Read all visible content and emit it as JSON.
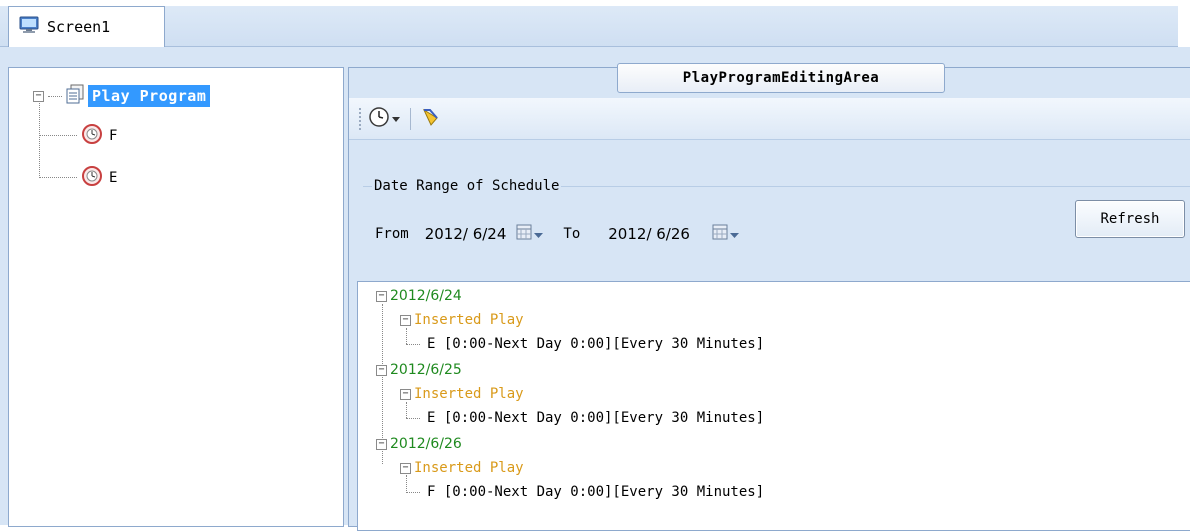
{
  "tabs": [
    {
      "label": "Screen1",
      "icon": "monitor-icon"
    }
  ],
  "program_tree": {
    "root": {
      "label": "Play Program",
      "icon": "pages-icon"
    },
    "children": [
      {
        "label": "F",
        "icon": "clock-icon"
      },
      {
        "label": "E",
        "icon": "clock-icon"
      }
    ]
  },
  "editing_area": {
    "title": "PlayProgramEditingArea",
    "toolbar": [
      {
        "name": "clock-dropdown",
        "icon": "clock-icon"
      },
      {
        "name": "clear-tool",
        "icon": "eraser-icon"
      }
    ],
    "schedule": {
      "caption": "Date Range of Schedule",
      "from_label": "From",
      "from_value": "2012/ 6/24",
      "to_label": "To",
      "to_value": "2012/ 6/26",
      "refresh_label": "Refresh"
    },
    "result": [
      {
        "date": "2012/6/24",
        "type": "Inserted Play",
        "entry": "E [0:00-Next Day 0:00][Every 30 Minutes]"
      },
      {
        "date": "2012/6/25",
        "type": "Inserted Play",
        "entry": "E [0:00-Next Day 0:00][Every 30 Minutes]"
      },
      {
        "date": "2012/6/26",
        "type": "Inserted Play",
        "entry": "F [0:00-Next Day 0:00][Every 30 Minutes]"
      }
    ]
  },
  "colors": {
    "date": "#1f8a1f",
    "play_type": "#d99a1a",
    "selection": "#3399ff"
  }
}
